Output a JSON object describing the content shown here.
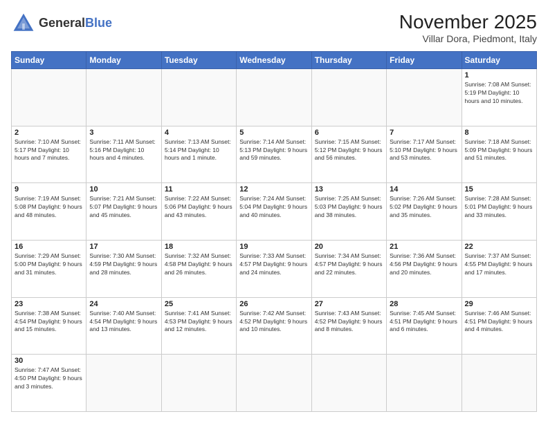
{
  "header": {
    "logo_general": "General",
    "logo_blue": "Blue",
    "title": "November 2025",
    "subtitle": "Villar Dora, Piedmont, Italy"
  },
  "weekdays": [
    "Sunday",
    "Monday",
    "Tuesday",
    "Wednesday",
    "Thursday",
    "Friday",
    "Saturday"
  ],
  "weeks": [
    [
      {
        "day": "",
        "info": ""
      },
      {
        "day": "",
        "info": ""
      },
      {
        "day": "",
        "info": ""
      },
      {
        "day": "",
        "info": ""
      },
      {
        "day": "",
        "info": ""
      },
      {
        "day": "",
        "info": ""
      },
      {
        "day": "1",
        "info": "Sunrise: 7:08 AM\nSunset: 5:19 PM\nDaylight: 10 hours and 10 minutes."
      }
    ],
    [
      {
        "day": "2",
        "info": "Sunrise: 7:10 AM\nSunset: 5:17 PM\nDaylight: 10 hours and 7 minutes."
      },
      {
        "day": "3",
        "info": "Sunrise: 7:11 AM\nSunset: 5:16 PM\nDaylight: 10 hours and 4 minutes."
      },
      {
        "day": "4",
        "info": "Sunrise: 7:13 AM\nSunset: 5:14 PM\nDaylight: 10 hours and 1 minute."
      },
      {
        "day": "5",
        "info": "Sunrise: 7:14 AM\nSunset: 5:13 PM\nDaylight: 9 hours and 59 minutes."
      },
      {
        "day": "6",
        "info": "Sunrise: 7:15 AM\nSunset: 5:12 PM\nDaylight: 9 hours and 56 minutes."
      },
      {
        "day": "7",
        "info": "Sunrise: 7:17 AM\nSunset: 5:10 PM\nDaylight: 9 hours and 53 minutes."
      },
      {
        "day": "8",
        "info": "Sunrise: 7:18 AM\nSunset: 5:09 PM\nDaylight: 9 hours and 51 minutes."
      }
    ],
    [
      {
        "day": "9",
        "info": "Sunrise: 7:19 AM\nSunset: 5:08 PM\nDaylight: 9 hours and 48 minutes."
      },
      {
        "day": "10",
        "info": "Sunrise: 7:21 AM\nSunset: 5:07 PM\nDaylight: 9 hours and 45 minutes."
      },
      {
        "day": "11",
        "info": "Sunrise: 7:22 AM\nSunset: 5:06 PM\nDaylight: 9 hours and 43 minutes."
      },
      {
        "day": "12",
        "info": "Sunrise: 7:24 AM\nSunset: 5:04 PM\nDaylight: 9 hours and 40 minutes."
      },
      {
        "day": "13",
        "info": "Sunrise: 7:25 AM\nSunset: 5:03 PM\nDaylight: 9 hours and 38 minutes."
      },
      {
        "day": "14",
        "info": "Sunrise: 7:26 AM\nSunset: 5:02 PM\nDaylight: 9 hours and 35 minutes."
      },
      {
        "day": "15",
        "info": "Sunrise: 7:28 AM\nSunset: 5:01 PM\nDaylight: 9 hours and 33 minutes."
      }
    ],
    [
      {
        "day": "16",
        "info": "Sunrise: 7:29 AM\nSunset: 5:00 PM\nDaylight: 9 hours and 31 minutes."
      },
      {
        "day": "17",
        "info": "Sunrise: 7:30 AM\nSunset: 4:59 PM\nDaylight: 9 hours and 28 minutes."
      },
      {
        "day": "18",
        "info": "Sunrise: 7:32 AM\nSunset: 4:58 PM\nDaylight: 9 hours and 26 minutes."
      },
      {
        "day": "19",
        "info": "Sunrise: 7:33 AM\nSunset: 4:57 PM\nDaylight: 9 hours and 24 minutes."
      },
      {
        "day": "20",
        "info": "Sunrise: 7:34 AM\nSunset: 4:57 PM\nDaylight: 9 hours and 22 minutes."
      },
      {
        "day": "21",
        "info": "Sunrise: 7:36 AM\nSunset: 4:56 PM\nDaylight: 9 hours and 20 minutes."
      },
      {
        "day": "22",
        "info": "Sunrise: 7:37 AM\nSunset: 4:55 PM\nDaylight: 9 hours and 17 minutes."
      }
    ],
    [
      {
        "day": "23",
        "info": "Sunrise: 7:38 AM\nSunset: 4:54 PM\nDaylight: 9 hours and 15 minutes."
      },
      {
        "day": "24",
        "info": "Sunrise: 7:40 AM\nSunset: 4:54 PM\nDaylight: 9 hours and 13 minutes."
      },
      {
        "day": "25",
        "info": "Sunrise: 7:41 AM\nSunset: 4:53 PM\nDaylight: 9 hours and 12 minutes."
      },
      {
        "day": "26",
        "info": "Sunrise: 7:42 AM\nSunset: 4:52 PM\nDaylight: 9 hours and 10 minutes."
      },
      {
        "day": "27",
        "info": "Sunrise: 7:43 AM\nSunset: 4:52 PM\nDaylight: 9 hours and 8 minutes."
      },
      {
        "day": "28",
        "info": "Sunrise: 7:45 AM\nSunset: 4:51 PM\nDaylight: 9 hours and 6 minutes."
      },
      {
        "day": "29",
        "info": "Sunrise: 7:46 AM\nSunset: 4:51 PM\nDaylight: 9 hours and 4 minutes."
      }
    ],
    [
      {
        "day": "30",
        "info": "Sunrise: 7:47 AM\nSunset: 4:50 PM\nDaylight: 9 hours and 3 minutes."
      },
      {
        "day": "",
        "info": ""
      },
      {
        "day": "",
        "info": ""
      },
      {
        "day": "",
        "info": ""
      },
      {
        "day": "",
        "info": ""
      },
      {
        "day": "",
        "info": ""
      },
      {
        "day": "",
        "info": ""
      }
    ]
  ]
}
